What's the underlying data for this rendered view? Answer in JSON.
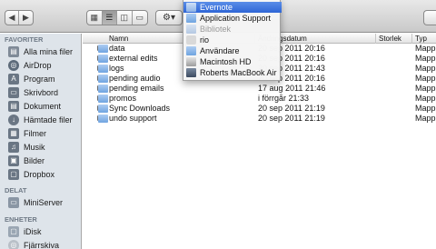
{
  "toolbar": {
    "nav": {
      "back_icon": "chevron-left-icon",
      "forward_icon": "chevron-right-icon"
    },
    "views": {
      "icon_view": "grid-icon",
      "list_view": "list-icon",
      "column_view": "columns-icon",
      "coverflow_view": "coverflow-icon"
    },
    "gear": "gear-icon"
  },
  "sidebar": {
    "sections": [
      {
        "title": "FAVORITER",
        "items": [
          {
            "label": "Alla mina filer",
            "icon": "all-files-icon"
          },
          {
            "label": "AirDrop",
            "icon": "airdrop-icon"
          },
          {
            "label": "Program",
            "icon": "applications-icon"
          },
          {
            "label": "Skrivbord",
            "icon": "desktop-icon"
          },
          {
            "label": "Dokument",
            "icon": "documents-icon"
          },
          {
            "label": "Hämtade filer",
            "icon": "downloads-icon"
          },
          {
            "label": "Filmer",
            "icon": "movies-icon"
          },
          {
            "label": "Musik",
            "icon": "music-icon"
          },
          {
            "label": "Bilder",
            "icon": "pictures-icon"
          },
          {
            "label": "Dropbox",
            "icon": "dropbox-icon"
          }
        ]
      },
      {
        "title": "DELAT",
        "items": [
          {
            "label": "MiniServer",
            "icon": "server-icon"
          }
        ]
      },
      {
        "title": "ENHETER",
        "items": [
          {
            "label": "iDisk",
            "icon": "idisk-icon"
          },
          {
            "label": "Fjärrskiva",
            "icon": "remote-disc-icon"
          }
        ]
      }
    ]
  },
  "columns": {
    "name": "Namn",
    "date": "Ändringsdatum",
    "size": "Storlek",
    "kind": "Typ"
  },
  "files": [
    {
      "name": "data",
      "date": "20 sep 2011 20:16",
      "kind": "Mapp"
    },
    {
      "name": "external edits",
      "date": "20 sep 2011 20:16",
      "kind": "Mapp"
    },
    {
      "name": "logs",
      "date": "20 sep 2011 21:43",
      "kind": "Mapp"
    },
    {
      "name": "pending audio",
      "date": "20 sep 2011 20:16",
      "kind": "Mapp"
    },
    {
      "name": "pending emails",
      "date": "17 aug 2011 21:46",
      "kind": "Mapp"
    },
    {
      "name": "promos",
      "date": "i förrgår 21:33",
      "kind": "Mapp"
    },
    {
      "name": "Sync Downloads",
      "date": "20 sep 2011 21:19",
      "kind": "Mapp"
    },
    {
      "name": "undo support",
      "date": "20 sep 2011 21:19",
      "kind": "Mapp"
    }
  ],
  "path_menu": {
    "items": [
      {
        "label": "Evernote",
        "icon": "folder-icon",
        "selected": true,
        "disabled": false
      },
      {
        "label": "Application Support",
        "icon": "folder-icon",
        "selected": false,
        "disabled": false
      },
      {
        "label": "Bibliotek",
        "icon": "library-folder-icon",
        "selected": false,
        "disabled": true
      },
      {
        "label": "rio",
        "icon": "home-icon",
        "selected": false,
        "disabled": false
      },
      {
        "label": "Användare",
        "icon": "users-folder-icon",
        "selected": false,
        "disabled": false
      },
      {
        "label": "Macintosh HD",
        "icon": "hard-drive-icon",
        "selected": false,
        "disabled": false
      },
      {
        "label": "Roberts MacBook Air",
        "icon": "computer-icon",
        "selected": false,
        "disabled": false
      }
    ]
  }
}
